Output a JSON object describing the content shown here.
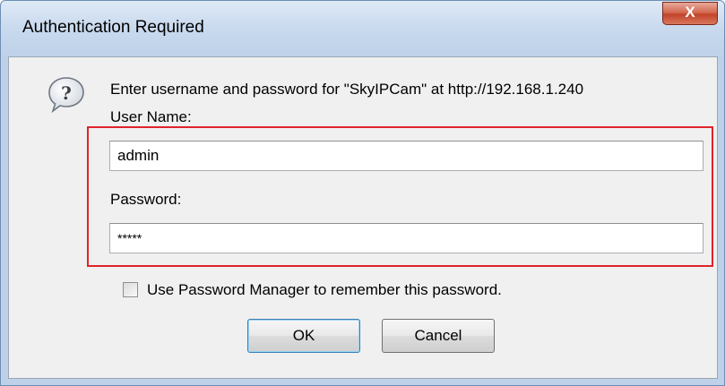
{
  "window": {
    "title": "Authentication Required",
    "close_glyph": "X"
  },
  "dialog": {
    "icon": "help-question-icon",
    "prompt": "Enter username and password for \"SkyIPCam\" at http://192.168.1.240",
    "username_label": "User Name:",
    "username_value": "admin",
    "password_label": "Password:",
    "password_value": "*****",
    "remember_label": "Use Password Manager to remember this password.",
    "remember_checked": false
  },
  "buttons": {
    "ok_label": "OK",
    "cancel_label": "Cancel"
  },
  "colors": {
    "highlight_box": "#e0232b",
    "close_button": "#c2432a"
  }
}
